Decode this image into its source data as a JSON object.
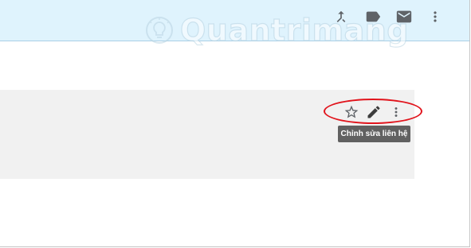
{
  "top_bar": {
    "background_color": "#dff3fd",
    "icons": [
      "merge-icon",
      "label-icon",
      "mail-icon",
      "more-vert-icon"
    ]
  },
  "watermark": {
    "text": "Quantrimang",
    "icon": "lightbulb-icon"
  },
  "contact_card": {
    "background_color": "#f1f1f1",
    "actions": [
      "star-icon",
      "edit-pencil-icon",
      "more-vert-icon"
    ]
  },
  "tooltip": {
    "text": "Chỉnh sửa liên hệ"
  },
  "highlight": {
    "color": "#e1141c"
  }
}
